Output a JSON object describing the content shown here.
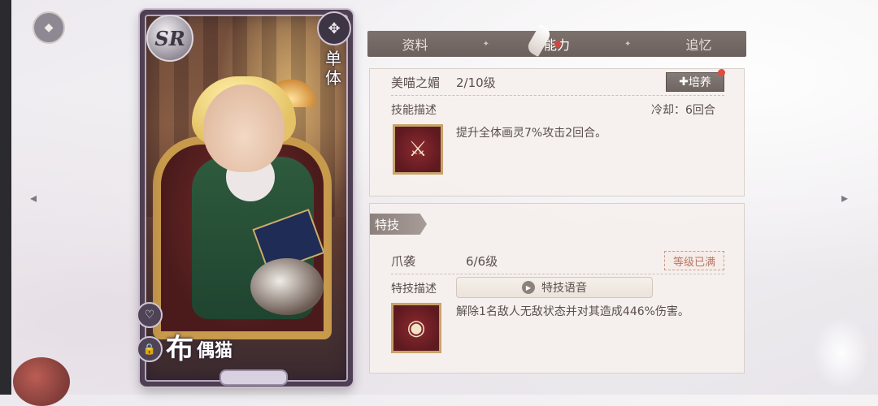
{
  "tabs": [
    {
      "label": "资料"
    },
    {
      "label": "能力"
    },
    {
      "label": "追忆"
    }
  ],
  "active_tab": "能力",
  "card": {
    "rarity": "SR",
    "type_label": "单体",
    "name_main": "布",
    "name_sub": "偶猫"
  },
  "skill": {
    "name": "美喵之媚",
    "level": "2/10级",
    "cultivate_label": "培养",
    "desc_label": "技能描述",
    "cooldown": "冷却：6回合",
    "description": "提升全体画灵7%攻击2回合。"
  },
  "special": {
    "section_label": "特技",
    "name": "爪袭",
    "level": "6/6级",
    "maxed_label": "等级已满",
    "desc_label": "特技描述",
    "voice_label": "特技语音",
    "description": "解除1名敌人无敌状态并对其造成446%伤害。"
  },
  "icons": {
    "back": "back-icon",
    "left_arrow": "arrow-left-icon",
    "right_arrow": "arrow-right-icon",
    "heart": "heart-icon",
    "lock": "lock-icon",
    "type": "target-icon",
    "play": "play-icon"
  },
  "colors": {
    "tab_bar": "#6b605c",
    "skill_icon_bg": "#8b2a2f",
    "red_dot": "#e04a3f",
    "maxed_text": "#b77767"
  }
}
